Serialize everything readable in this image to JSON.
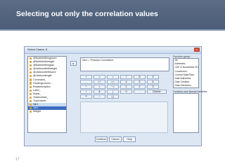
{
  "slide": {
    "title": "Selecting out only the correlation values",
    "page_number": "17"
  },
  "dialog": {
    "title": "Select Cases: If",
    "close": "x",
    "move_arrow": "▸",
    "variables": [
      {
        "label": "@Noblebirthingscore",
        "state": "normal"
      },
      {
        "label": "@Noblebirthweight",
        "state": "normal"
      },
      {
        "label": "@Noblebirthingcla...",
        "state": "normal"
      },
      {
        "label": "@Jacksonbirthweight",
        "state": "normal"
      },
      {
        "label": "@Jacksonbirthscore",
        "state": "normal"
      },
      {
        "label": "@Jacksonlength",
        "state": "normal"
      },
      {
        "label": "Command_",
        "state": "normal"
      },
      {
        "label": "Feadingcolumn...",
        "state": "normal"
      },
      {
        "label": "Rowdescription",
        "state": "normal"
      },
      {
        "label": "Label_",
        "state": "normal"
      },
      {
        "label": "Noble_",
        "state": "normal"
      },
      {
        "label": "Totalnumber_",
        "state": "normal"
      },
      {
        "label": "Tropicaside",
        "state": "normal"
      },
      {
        "label": "Var1",
        "state": "sel"
      },
      {
        "label": "Var2",
        "state": "focus"
      },
      {
        "label": "Weight",
        "state": "normal"
      }
    ],
    "expression": "Var1 = 'Pearson Correlation'",
    "calculator": {
      "rows": [
        [
          "+",
          "<",
          ">",
          "7",
          "8",
          "9"
        ],
        [
          "-",
          "<=",
          ">=",
          "4",
          "5",
          "6"
        ],
        [
          "*",
          "=",
          "~=",
          "1",
          "2",
          "3"
        ],
        [
          "/",
          "&",
          "|",
          "0",
          ".",
          "Delete"
        ],
        [
          "**",
          "~",
          "( )"
        ]
      ]
    },
    "function_group_label": "Function group:",
    "function_groups": [
      "All",
      "Arithmetic",
      "CDF & Noncentral CDF",
      "Conversion",
      "Current Date/Time",
      "Date Arithmetic",
      "Date Creation",
      "Date Extraction"
    ],
    "functions_label": "Functions and Special Variables:",
    "buttons": [
      "Continue",
      "Cancel",
      "Help"
    ]
  }
}
